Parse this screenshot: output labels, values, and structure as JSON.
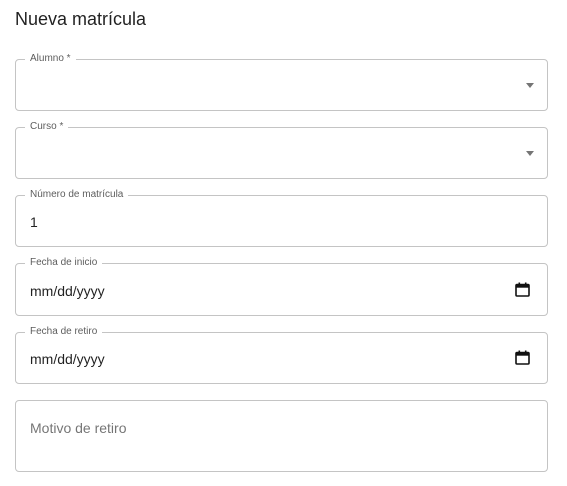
{
  "form": {
    "title": "Nueva matrícula",
    "fields": {
      "alumno": {
        "label": "Alumno *",
        "value": "",
        "icon": "chevron-down-icon"
      },
      "curso": {
        "label": "Curso *",
        "value": "",
        "icon": "chevron-down-icon"
      },
      "numero": {
        "label": "Número de matrícula",
        "value": "1"
      },
      "fecha_inicio": {
        "label": "Fecha de inicio",
        "value": "mm/dd/yyyy",
        "icon": "calendar-icon"
      },
      "fecha_retiro": {
        "label": "Fecha de retiro",
        "value": "mm/dd/yyyy",
        "icon": "calendar-icon"
      },
      "motivo": {
        "placeholder": "Motivo de retiro",
        "value": ""
      }
    }
  }
}
